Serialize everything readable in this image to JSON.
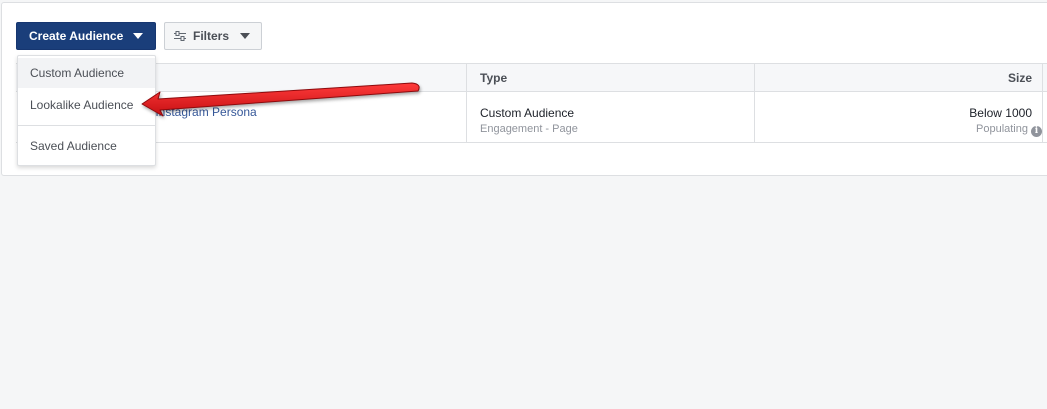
{
  "toolbar": {
    "create_label": "Create Audience",
    "filters_label": "Filters"
  },
  "dropdown": {
    "items": [
      {
        "label": "Custom Audience"
      },
      {
        "label": "Lookalike Audience"
      },
      {
        "label": "Saved Audience"
      }
    ]
  },
  "table": {
    "columns": [
      "Type",
      "Size"
    ],
    "rows": [
      {
        "name": "r Instagram Persona",
        "type": "Custom Audience",
        "type_sub": "Engagement - Page",
        "size": "Below 1000",
        "size_status": "Populating"
      }
    ]
  },
  "colors": {
    "primary_button": "#1a3e7a",
    "link": "#365899",
    "annotation_arrow": "#e8151b"
  },
  "icons": {
    "filters": "sliders-icon",
    "info": "info-circle-icon",
    "annotation": "red-arrow-annotation"
  }
}
